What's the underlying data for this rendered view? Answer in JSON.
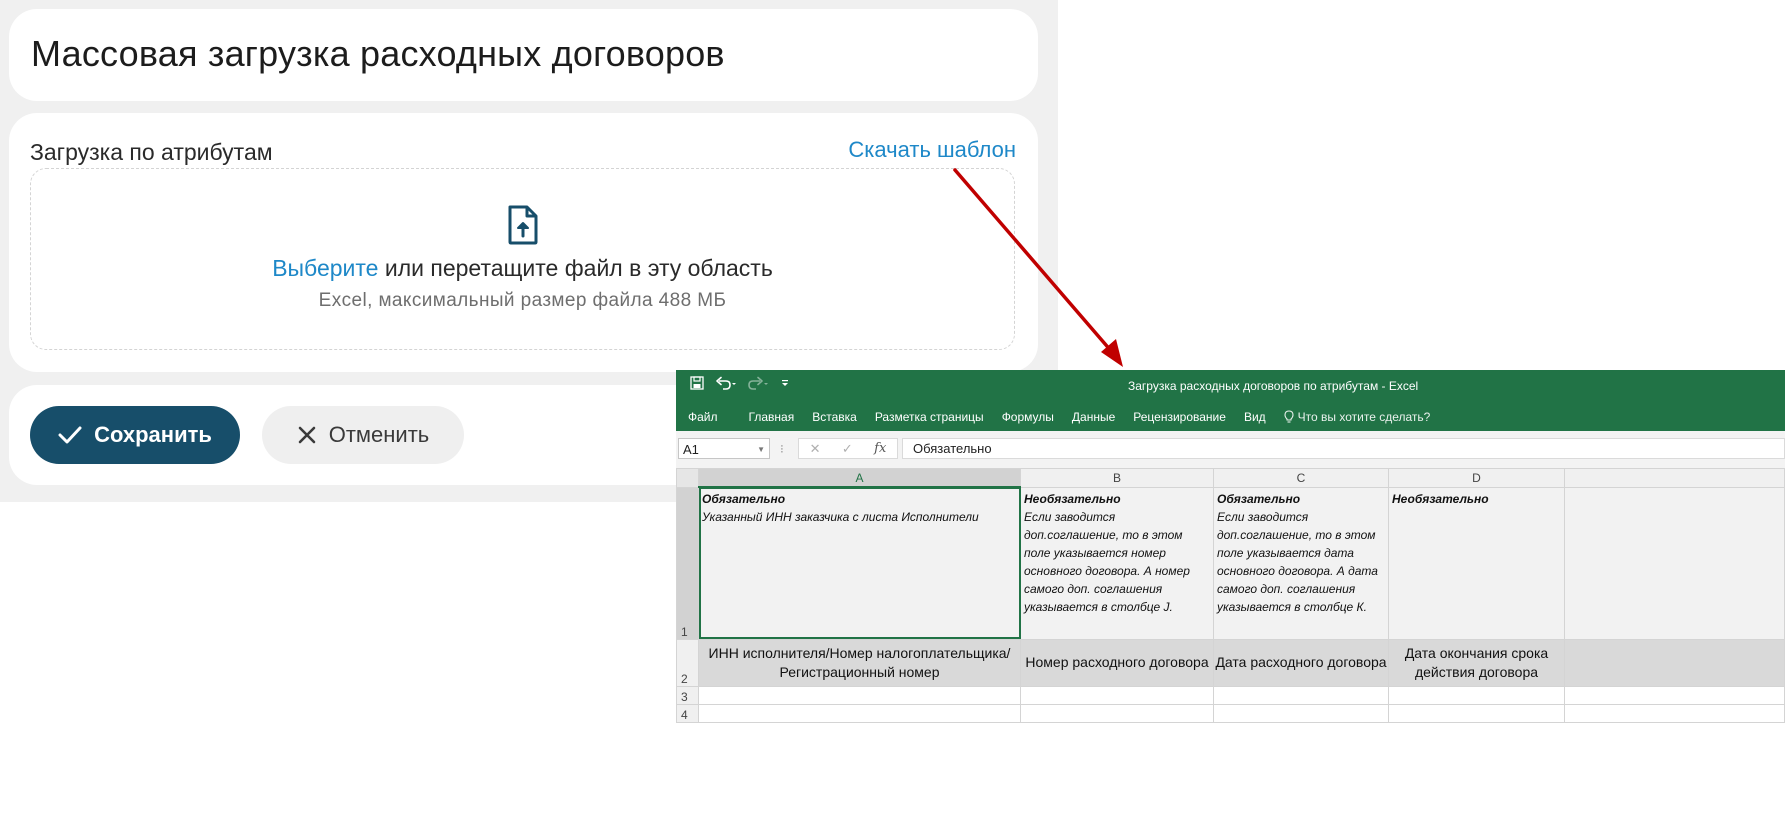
{
  "page": {
    "title": "Массовая загрузка расходных договоров",
    "section_label": "Загрузка по атрибутам",
    "download_link": "Скачать шаблон",
    "dropzone": {
      "choose_link": "Выберите",
      "main_text": " или перетащите файл в эту область",
      "hint": "Excel, максимальный размер файла 488 МБ",
      "icon": "file-upload-icon"
    },
    "actions": {
      "save_label": "Сохранить",
      "cancel_label": "Отменить",
      "save_icon": "check-icon",
      "cancel_icon": "close-icon"
    },
    "colors": {
      "primary": "#174e6a",
      "link": "#1e88c8",
      "arrow": "#c00000",
      "excel_green": "#217346"
    }
  },
  "excel": {
    "window_title": "Загрузка расходных договоров по атрибутам - Excel",
    "qat": [
      "save-icon",
      "undo-icon",
      "redo-icon",
      "customize-icon"
    ],
    "tabs": [
      "Файл",
      "Главная",
      "Вставка",
      "Разметка страницы",
      "Формулы",
      "Данные",
      "Рецензирование",
      "Вид"
    ],
    "tell_me": "Что вы хотите сделать?",
    "name_box": "A1",
    "formula_value": "Обязательно",
    "columns": [
      "A",
      "B",
      "C",
      "D"
    ],
    "rows": [
      "1",
      "2",
      "3",
      "4"
    ],
    "row1": [
      {
        "title": "Обязательно",
        "text": "Указанный ИНН заказчика с листа Исполнители"
      },
      {
        "title": "Необязательно",
        "text": "Если заводится доп.соглашение, то в этом поле указывается номер основного договора. А номер самого доп. соглашения указывается в столбце J."
      },
      {
        "title": "Обязательно",
        "text": "Если заводится доп.соглашение, то в этом поле указывается дата основного договора. А дата самого доп. соглашения указывается в столбце К."
      },
      {
        "title": "Необязательно",
        "text": ""
      }
    ],
    "row2": [
      "ИНН исполнителя/Номер налогоплательщика/Регистрационный номер",
      "Номер расходного договора",
      "Дата расходного договора",
      "Дата окончания срока действия договора"
    ]
  }
}
